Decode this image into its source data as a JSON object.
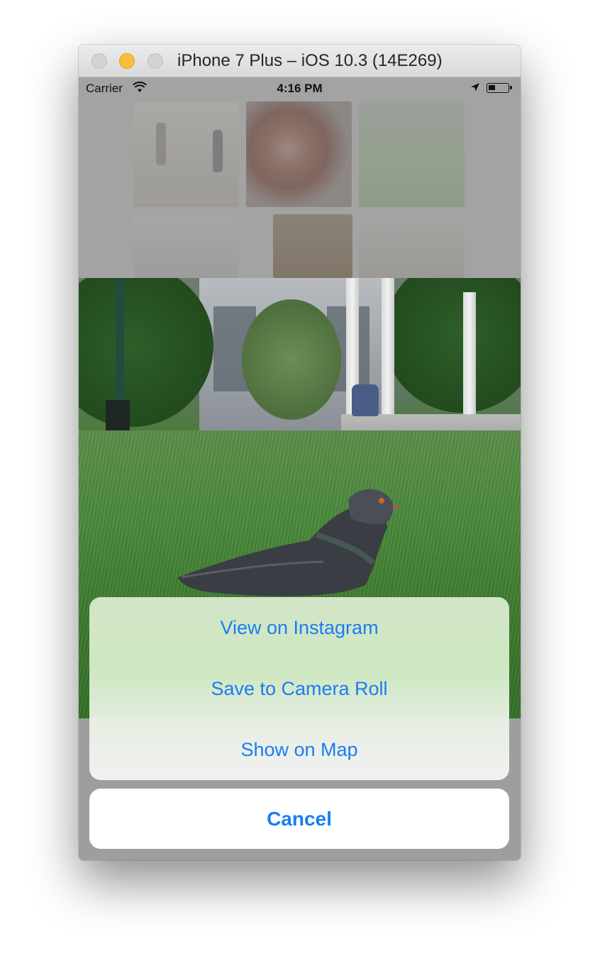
{
  "window": {
    "title": "iPhone 7 Plus – iOS 10.3 (14E269)"
  },
  "status_bar": {
    "carrier": "Carrier",
    "time": "4:16 PM",
    "icons": [
      "wifi-icon",
      "location-arrow-icon",
      "battery-icon"
    ]
  },
  "action_sheet": {
    "actions": [
      {
        "label": "View on Instagram"
      },
      {
        "label": "Save to Camera Roll"
      },
      {
        "label": "Show on Map"
      }
    ],
    "cancel_label": "Cancel",
    "accent_color": "#1a7ef2"
  }
}
